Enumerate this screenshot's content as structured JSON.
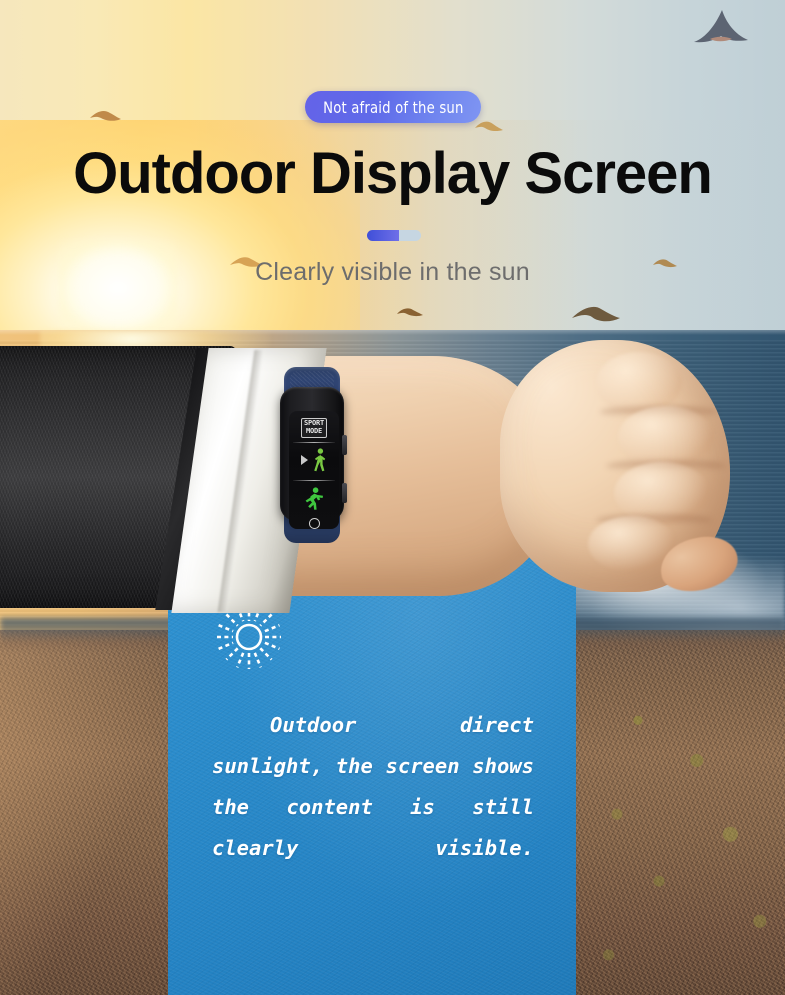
{
  "poster": {
    "badge": {
      "label": "Not afraid of the sun"
    },
    "headline": "Outdoor Display Screen",
    "subheadline": "Clearly visible in the sun",
    "divider": {
      "accent_color": "#4a55dc",
      "track_color": "#c6d6e2"
    },
    "colors": {
      "badge_gradient_start": "#6463e8",
      "badge_gradient_end": "#7f95f2",
      "headline": "#0b0b0b",
      "subheadline": "#6d6d6d",
      "panel_blue": "#2a8bcb",
      "band_strap": "#32487a",
      "screen_icon_green": "#7ac943"
    }
  },
  "device": {
    "name": "fitness-band",
    "screen": {
      "mode_label_line1": "SPORT",
      "mode_label_line2": "MODE",
      "items": [
        {
          "icon": "walking-figure-icon",
          "selected": true,
          "marker": "play-triangle-icon"
        },
        {
          "icon": "running-figure-icon",
          "selected": false
        }
      ],
      "home_button": "circle-home-icon"
    }
  },
  "info_panel": {
    "icon": "sun-icon",
    "body": "Outdoor direct sunlight, the screen shows the content is still clearly visible."
  },
  "scene": {
    "background": "sunset-beach-ocean-photo",
    "elements": [
      "sun-glow",
      "ocean-horizon",
      "seagulls",
      "sandy-beach",
      "suit-sleeve",
      "shirt-cuff",
      "hand-fist"
    ]
  }
}
